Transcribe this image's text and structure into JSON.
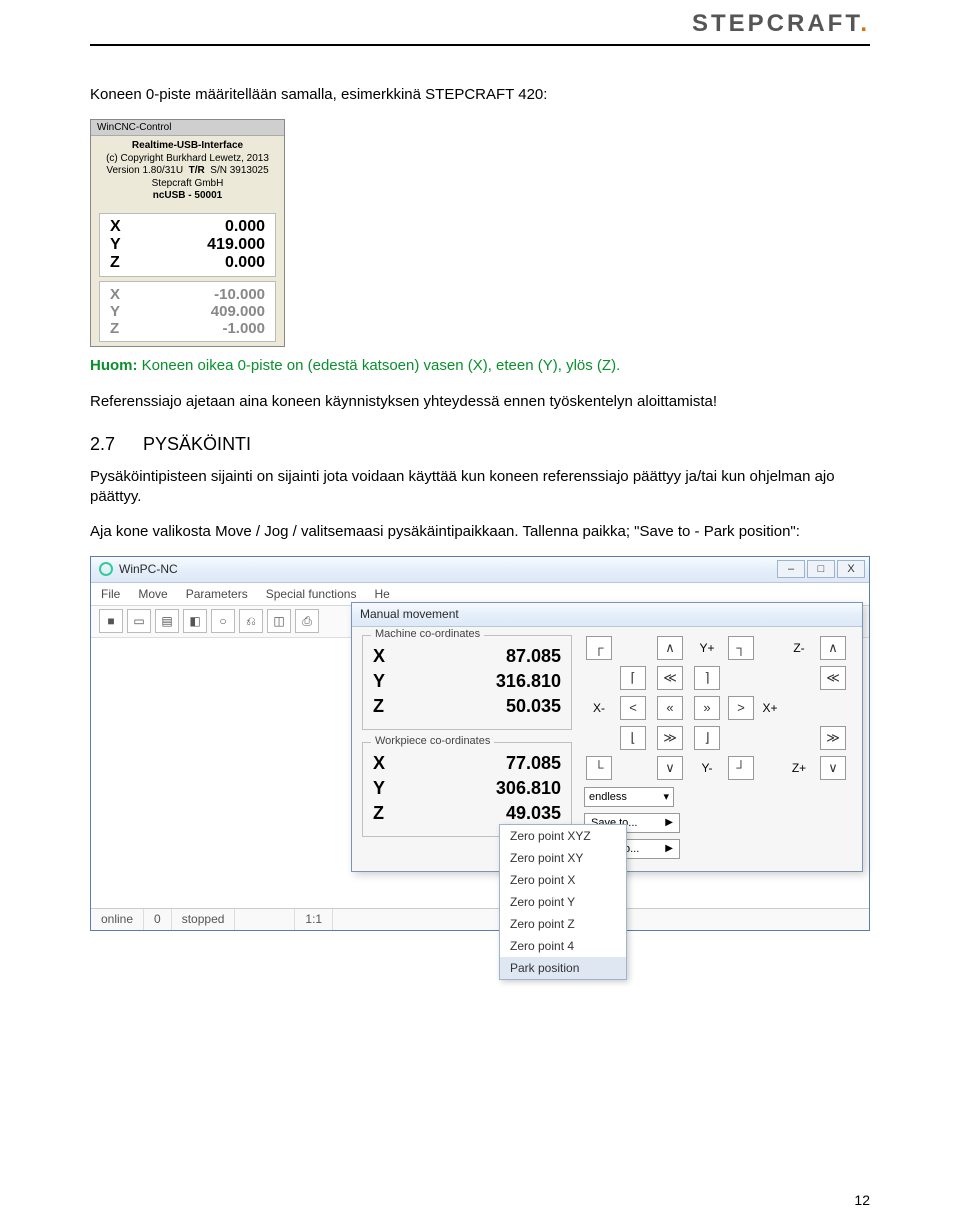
{
  "header": {
    "logo": "STEPCRAFT",
    "logo_dot": "."
  },
  "intro_text": "Koneen 0-piste määritellään samalla, esimerkkinä STEPCRAFT 420:",
  "wincnc": {
    "title": "WinCNC-Control",
    "meta1": "Realtime-USB-Interface",
    "meta2": "(c) Copyright Burkhard Lewetz, 2013",
    "meta3a": "Version 1.80/31U",
    "meta3b": "T/R",
    "meta3c": "S/N 3913025",
    "meta4": "Stepcraft GmbH",
    "meta5": "ncUSB - 50001",
    "active": [
      {
        "axis": "X",
        "val": "0.000"
      },
      {
        "axis": "Y",
        "val": "419.000"
      },
      {
        "axis": "Z",
        "val": "0.000"
      }
    ],
    "muted": [
      {
        "axis": "X",
        "val": "-10.000"
      },
      {
        "axis": "Y",
        "val": "409.000"
      },
      {
        "axis": "Z",
        "val": "-1.000"
      }
    ]
  },
  "note": {
    "label": "Huom:",
    "text": " Koneen oikea 0-piste on (edestä katsoen) vasen (X), eteen (Y), ylös (Z)."
  },
  "ref_text": "Referenssiajo ajetaan aina koneen käynnistyksen yhteydessä ennen työskentelyn aloittamista!",
  "section": {
    "num": "2.7",
    "title": "PYSÄKÖINTI"
  },
  "section_p1": "Pysäköintipisteen sijainti on sijainti jota voidaan käyttää kun koneen referenssiajo päättyy ja/tai kun ohjelman ajo päättyy.",
  "section_p2": "Aja kone valikosta Move / Jog / valitsemaasi pysäkäintipaikkaan. Tallenna paikka; \"Save to - Park position\":",
  "winpc": {
    "title": "WinPC-NC",
    "menus": [
      "File",
      "Move",
      "Parameters",
      "Special functions",
      "He"
    ],
    "toolbar_glyphs": [
      "■",
      "▭",
      "▤",
      "◧",
      "○",
      "⎌",
      "◫",
      "⎙"
    ],
    "status": {
      "s1": "online",
      "s2": "0",
      "s3": "stopped",
      "s4": "1:1"
    }
  },
  "mm": {
    "title": "Manual movement",
    "grp1_legend": "Machine co-ordinates",
    "grp2_legend": "Workpiece co-ordinates",
    "machine": [
      {
        "axis": "X",
        "val": "87.085"
      },
      {
        "axis": "Y",
        "val": "316.810"
      },
      {
        "axis": "Z",
        "val": "50.035"
      }
    ],
    "workpiece": [
      {
        "axis": "X",
        "val": "77.085"
      },
      {
        "axis": "Y",
        "val": "306.810"
      },
      {
        "axis": "Z",
        "val": "49.035"
      }
    ],
    "xminus": "X-",
    "xplus": "X+",
    "yminus": "Y-",
    "yplus": "Y+",
    "zminus": "Z-",
    "zplus": "Z+",
    "dropdown": "endless",
    "saveto": "Save to...",
    "moveto": "Move to..."
  },
  "zero_menu": [
    "Zero point XYZ",
    "Zero point XY",
    "Zero point X",
    "Zero point Y",
    "Zero point Z",
    "Zero point 4",
    "Park position"
  ],
  "page_number": "12",
  "winbtns": {
    "min": "–",
    "max": "□",
    "close": "X"
  }
}
